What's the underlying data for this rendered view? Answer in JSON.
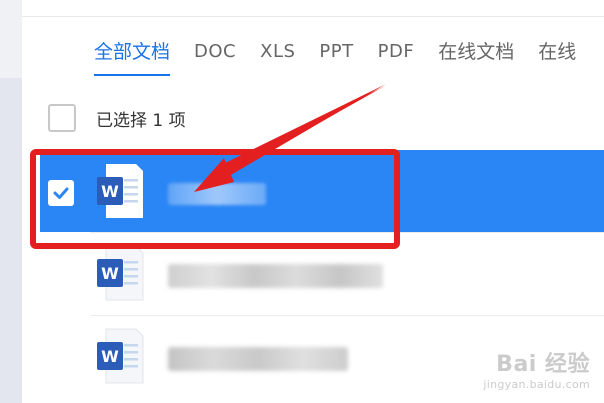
{
  "tabs": [
    {
      "label": "全部文档",
      "active": true
    },
    {
      "label": "DOC",
      "active": false
    },
    {
      "label": "XLS",
      "active": false
    },
    {
      "label": "PPT",
      "active": false
    },
    {
      "label": "PDF",
      "active": false
    },
    {
      "label": "在线文档",
      "active": false
    },
    {
      "label": "在线",
      "active": false
    }
  ],
  "selection": {
    "text": "已选择 1 项"
  },
  "files": [
    {
      "name": "",
      "icon": "word-doc-icon",
      "selected": true
    },
    {
      "name": "",
      "icon": "word-doc-icon",
      "selected": false
    },
    {
      "name": "",
      "icon": "word-doc-icon",
      "selected": false
    }
  ],
  "watermark": {
    "logo": "Bai 经验",
    "url": "jingyan.baidu.com"
  },
  "colors": {
    "accent": "#1a73e8",
    "selected_row": "#2b86f5",
    "annotation": "#e41f1f",
    "word_blue": "#2b5cb8"
  }
}
